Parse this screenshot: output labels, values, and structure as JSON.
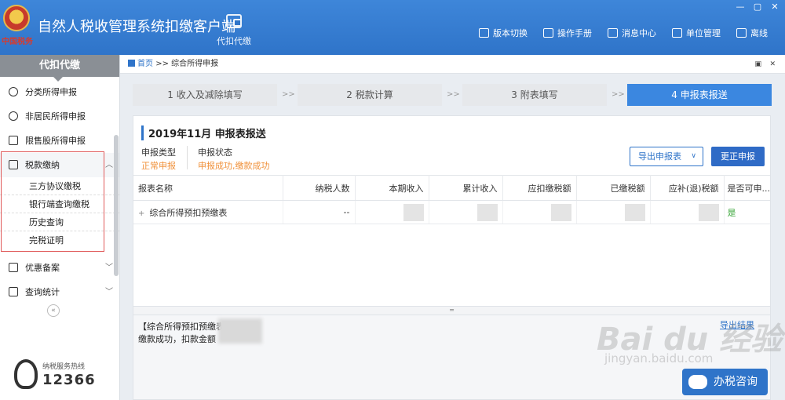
{
  "header": {
    "emblem_text": "中国税务",
    "app_title": "自然人税收管理系统扣缴客户端",
    "module_label": "代扣代缴",
    "window_controls": [
      "—",
      "▢",
      "✕"
    ],
    "toolbar": [
      {
        "label": "版本切换",
        "icon": "switch-icon"
      },
      {
        "label": "操作手册",
        "icon": "manual-icon"
      },
      {
        "label": "消息中心",
        "icon": "mail-icon"
      },
      {
        "label": "单位管理",
        "icon": "building-icon"
      },
      {
        "label": "离线",
        "icon": "offline-icon"
      }
    ]
  },
  "sidebar": {
    "title": "代扣代缴",
    "items": [
      {
        "label": "分类所得申报",
        "icon": "pie-icon"
      },
      {
        "label": "非居民所得申报",
        "icon": "person-icon"
      },
      {
        "label": "限售股所得申报",
        "icon": "bar-chart-icon"
      },
      {
        "label": "税款缴纳",
        "icon": "folder-icon",
        "expanded": true
      }
    ],
    "sub_items": [
      "三方协议缴税",
      "银行端查询缴税",
      "历史查询",
      "完税证明"
    ],
    "bottom_items": [
      {
        "label": "优惠备案",
        "icon": "doc-icon"
      },
      {
        "label": "查询统计",
        "icon": "list-icon"
      }
    ],
    "collapse_glyph": "«",
    "hotline_label": "纳税服务热线",
    "hotline_number": "12366"
  },
  "breadcrumb": {
    "home": "首页",
    "separator": ">>",
    "current": "综合所得申报",
    "pin": "▣",
    "close": "✕"
  },
  "steps": [
    {
      "label": "1 收入及减除填写",
      "active": false
    },
    {
      "label": "2 税款计算",
      "active": false
    },
    {
      "label": "3 附表填写",
      "active": false
    },
    {
      "label": "4 申报表报送",
      "active": true
    }
  ],
  "step_separator": ">>",
  "panel": {
    "title": "2019年11月  申报表报送",
    "type_label": "申报类型",
    "type_value": "正常申报",
    "status_label": "申报状态",
    "status_value": "申报成功,缴款成功",
    "export_button": "导出申报表",
    "correct_button": "更正申报"
  },
  "table": {
    "columns": [
      "报表名称",
      "纳税人数",
      "本期收入",
      "累计收入",
      "应扣缴税额",
      "已缴税额",
      "应补(退)税额",
      "是否可申..."
    ],
    "rows": [
      {
        "expander": "+",
        "name": "综合所得预扣预缴表",
        "taxpayers": "--",
        "yes": "是"
      }
    ]
  },
  "log": {
    "line1": "【综合所得预扣预缴表",
    "line2": "缴款成功，扣款金额",
    "export_link": "导出结果"
  },
  "consult_button": "办税咨询",
  "watermark": {
    "main": "Bai du 经验",
    "sub": "jingyan.baidu.com"
  },
  "colors": {
    "header": "#2f74c9",
    "accent": "#3b87e0",
    "warning": "#f0913a",
    "success": "#3aa63a",
    "highlight_border": "#e05a5a"
  }
}
